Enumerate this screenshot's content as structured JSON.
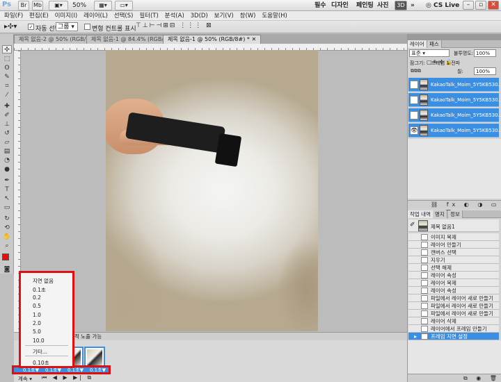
{
  "app": {
    "logo": "Ps",
    "zoom": "50%",
    "workspaces": [
      "필수",
      "디자인",
      "페인팅",
      "사진"
    ],
    "extra": "»",
    "cs_live": "CS Live"
  },
  "menu": [
    "파일(F)",
    "편집(E)",
    "이미지(I)",
    "레이어(L)",
    "선택(S)",
    "필터(T)",
    "분석(A)",
    "3D(D)",
    "보기(V)",
    "창(W)",
    "도움말(H)"
  ],
  "options": {
    "auto_select_label": "자동 선택:",
    "auto_select_value": "그룹",
    "show_transform_label": "변형 컨트롤 표시"
  },
  "tabs": [
    {
      "label": "제목 없음-2 @ 50% (RGB/8)"
    },
    {
      "label": "제목 없음-1 @ 84.4% (RGB/8#)"
    },
    {
      "label": "제목 없음-1 @ 50% (RGB/8#) *"
    }
  ],
  "timeline": {
    "tab_label": "적 노출 가능"
  },
  "delay_menu": {
    "items": [
      "지연 없음",
      "0.1초",
      "0.2",
      "0.5",
      "1.0",
      "2.0",
      "5.0",
      "10.0",
      "기타...",
      "0.10초"
    ]
  },
  "delays": [
    "0.1초▼",
    "0.1초▼",
    "0.1초▼",
    "0.1초▼"
  ],
  "timeline_loop": "계속",
  "layers_panel": {
    "tabs": [
      "레이어",
      "패스"
    ],
    "blend": "표준",
    "opacity_label": "불투명도:",
    "opacity": "100%",
    "fill_label": "칠:",
    "fill": "100%",
    "frame_label": "프레임 1 전파",
    "lock_label": "잠그기:",
    "layers": [
      {
        "name": "KakaoTalk_Moim_5Y5KB530..."
      },
      {
        "name": "KakaoTalk_Moim_5Y5KB530..."
      },
      {
        "name": "KakaoTalk_Moim_5Y5KB530..."
      },
      {
        "name": "KakaoTalk_Moim_5Y5KB530..."
      }
    ]
  },
  "history_panel": {
    "tabs": [
      "작업 내역",
      "명지",
      "정보"
    ],
    "snapshot": "제목 없음1",
    "items": [
      "이미지 복제",
      "레이어 만들기",
      "캔버스 선택",
      "지우기",
      "선택 해제",
      "레이어 속성",
      "레이어 복제",
      "레이어 속성",
      "파일에서 레이어 새로 만들기",
      "파일에서 레이어 새로 만들기",
      "파일에서 레이어 새로 만들기",
      "레이어 삭제",
      "레이어에서 프레임 만들기",
      "프레임 지연 설정"
    ]
  },
  "colors": {
    "accent": "#3b8fe3",
    "highlight": "#e01010"
  }
}
